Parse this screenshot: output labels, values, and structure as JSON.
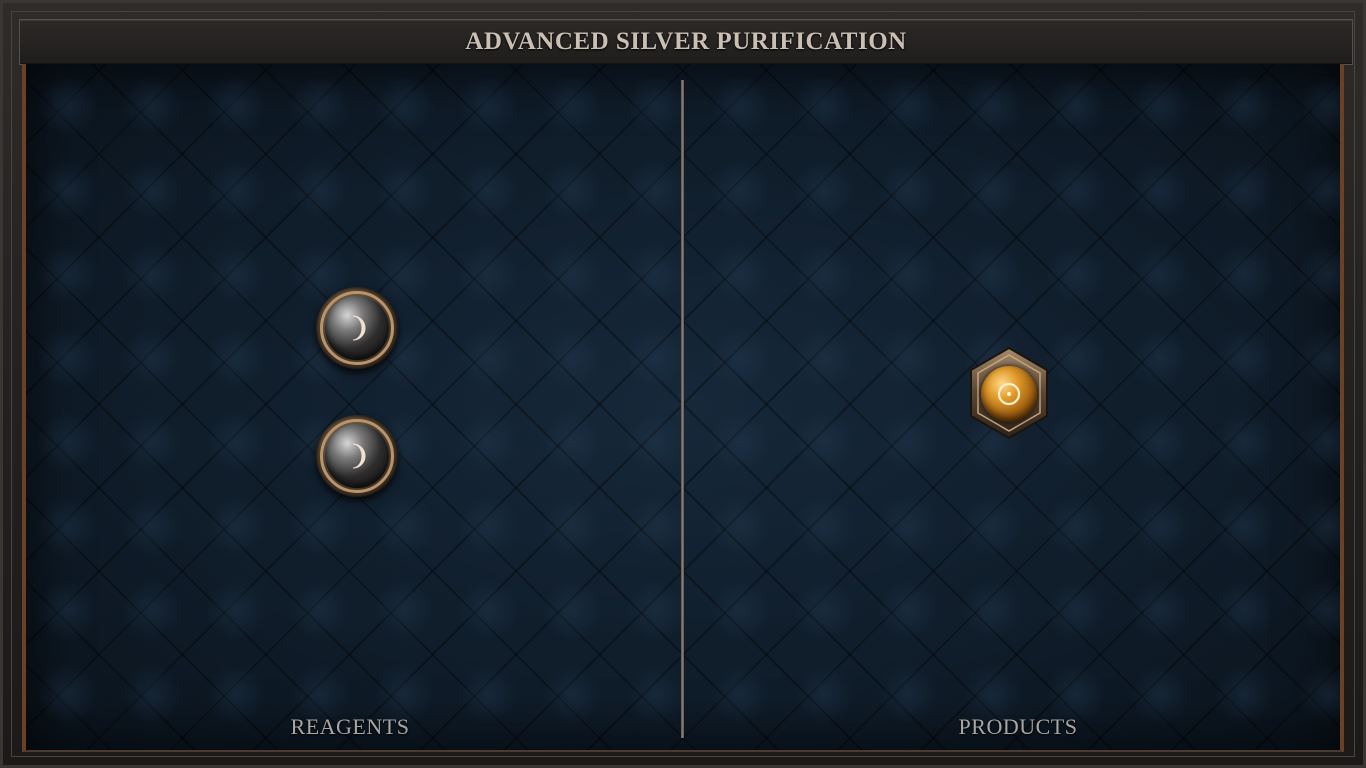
{
  "title": "ADVANCED SILVER PURIFICATION",
  "panels": {
    "reagents_label": "REAGENTS",
    "products_label": "PRODUCTS"
  },
  "reagents": [
    {
      "icon": "silver-moon-icon",
      "material": "silver"
    },
    {
      "icon": "silver-moon-icon",
      "material": "silver"
    }
  ],
  "products": [
    {
      "icon": "gold-sun-icon",
      "material": "gold"
    }
  ],
  "colors": {
    "board": "#0f1b26",
    "accent_copper": "#6b4126",
    "title_text": "#c9bfb2",
    "label_text": "#a8a6a3",
    "silver_glyph": "#f0e2d0",
    "gold_glyph": "#fff1cf"
  }
}
